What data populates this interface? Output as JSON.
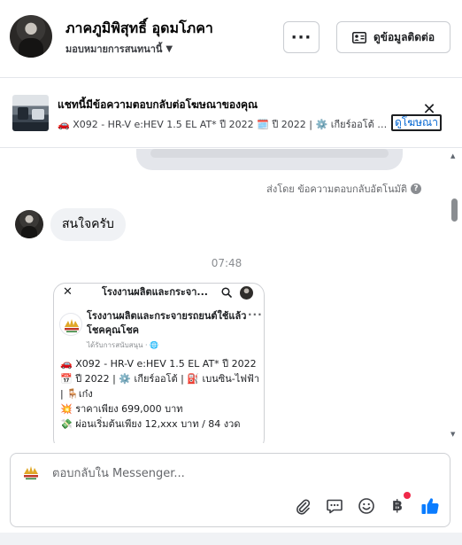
{
  "header": {
    "name": "ภาคภูมิพิสุทธิ์ อุดมโภคา",
    "subtitle": "มอบหมายการสนทนานี้",
    "more_label": "···",
    "contact_label": "ดูข้อมูลติดต่อ"
  },
  "ad_banner": {
    "title": "แชทนี้มีข้อความตอบกลับต่อโฆษณาของคุณ",
    "detail": "🚗 X092 - HR-V e:HEV 1.5 EL AT* ปี 2022 🗓️ ปี 2022 | ⚙️ เกียร์ออโต้ | ⛽ เบนซิน-ไฟฟ้า",
    "view_ad_label": "ดูโฆษณา",
    "close_label": "✕"
  },
  "conversation": {
    "sent_by": "ส่งโดย ข้อความตอบกลับอัตโนมัติ",
    "info_icon_label": "?",
    "message": "สนใจครับ",
    "timestamp": "07:48",
    "shared_screenshot": {
      "close_label": "✕",
      "title": "โรงงานผลิตและกระจา...",
      "page_name": "โรงงานผลิตและกระจายรถยนต์ใช้แล้ว โชคคุณโชค",
      "more_label": "···",
      "meta": "ได้รับการสนับสนุน · 🌐",
      "lines": [
        "🚗 X092 - HR-V e:HEV 1.5 EL AT* ปี 2022",
        "📅 ปี 2022 | ⚙️ เกียร์ออโต้ | ⛽ เบนซิน-ไฟฟ้า | 🪑เก๋ง",
        "💥 ราคาเพียง 699,000 บาท",
        "💸 ผ่อนเริ่มต้นเพียง 12,xxx บาท / 84 งวด"
      ]
    }
  },
  "composer": {
    "placeholder": "ตอบกลับใน Messenger...",
    "tools": [
      "paperclip-icon",
      "saved-reply-icon",
      "emoji-icon",
      "baht-payment-icon",
      "thumbs-up-icon"
    ],
    "baht_symbol": "฿"
  },
  "colors": {
    "link_blue": "#0064d1",
    "like_blue": "#0a7cff",
    "bubble_gray": "#f0f2f5",
    "notification_red": "#f02849"
  }
}
